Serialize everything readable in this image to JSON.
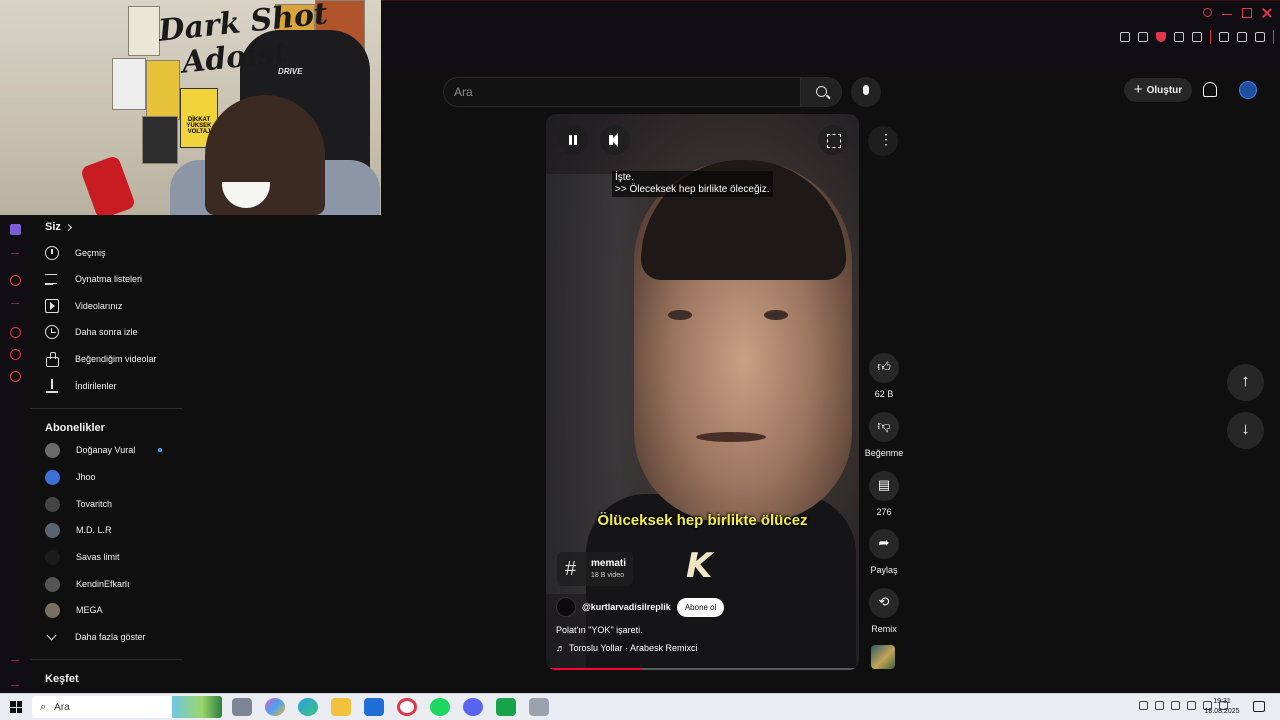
{
  "webcam": {
    "overlay_title_line1": "Dark Shot",
    "overlay_title_line2": "Adoist",
    "chair_brand": "DRIVE",
    "warning_sign": "DİKKAT YÜKSEK VOLTAJ"
  },
  "header": {
    "search_placeholder": "Ara",
    "create_label": "Oluştur"
  },
  "sidebar": {
    "you_section": "Siz",
    "you_items": [
      {
        "label": "Geçmiş",
        "icon": "history-icon"
      },
      {
        "label": "Oynatma listeleri",
        "icon": "playlist-icon"
      },
      {
        "label": "Videolarınız",
        "icon": "your-videos-icon"
      },
      {
        "label": "Daha sonra izle",
        "icon": "watch-later-icon"
      },
      {
        "label": "Beğendiğim videolar",
        "icon": "like-icon"
      },
      {
        "label": "İndirilenler",
        "icon": "download-icon"
      }
    ],
    "subscriptions_title": "Abonelikler",
    "subscriptions": [
      {
        "label": "Doğanay Vural",
        "new": true
      },
      {
        "label": "Jhoo",
        "new": false
      },
      {
        "label": "Tovaritch",
        "new": false
      },
      {
        "label": "M.D. L.R",
        "new": false
      },
      {
        "label": "Savas limit",
        "new": false
      },
      {
        "label": "KendinEfkarlı",
        "new": false
      },
      {
        "label": "MEGA",
        "new": false
      }
    ],
    "show_more": "Daha fazla göster",
    "explore_title": "Keşfet"
  },
  "short": {
    "caption_line1": "İşte.",
    "caption_line2": ">> Öleceksek hep birlikte öleceğiz.",
    "burned_subtitle": "Ölüceksek hep birlikte ölücez",
    "logo_letter": "K",
    "hashtag": "memati",
    "hashtag_count": "18 B video",
    "channel": "@kurtlarvadisilreplik",
    "subscribe_label": "Abone ol",
    "title": "Polat'ın \"YOK\" işareti.",
    "music": "Toroslu Yollar · Arabesk Remixci",
    "progress": 0.3
  },
  "actions": {
    "like_count": "62 B",
    "dislike_label": "Beğenme",
    "comment_count": "276",
    "share_label": "Paylaş",
    "remix_label": "Remix"
  },
  "taskbar": {
    "search_placeholder": "Ara",
    "time": "19:31",
    "date": "18.08.2025"
  },
  "colors": {
    "accent": "#e0364c",
    "subtitle_yellow": "#f3ee4a",
    "progress_red": "#ff0033",
    "background": "#0f0f0f"
  }
}
